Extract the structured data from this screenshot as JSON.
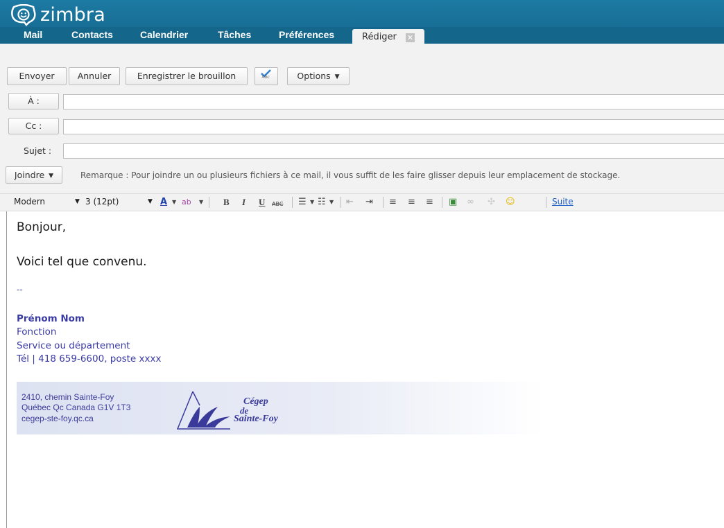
{
  "app": {
    "name": "zimbra"
  },
  "nav": {
    "tabs": [
      "Mail",
      "Contacts",
      "Calendrier",
      "Tâches",
      "Préférences"
    ],
    "active_tab": "Rédiger",
    "close_glyph": "✕"
  },
  "toolbar": {
    "send": "Envoyer",
    "cancel": "Annuler",
    "save_draft": "Enregistrer le brouillon",
    "spellcheck_text": "Abc",
    "options": "Options"
  },
  "fields": {
    "to_label": "À :",
    "cc_label": "Cc :",
    "subject_label": "Sujet :",
    "to_value": "",
    "cc_value": "",
    "subject_value": ""
  },
  "attach": {
    "label": "Joindre",
    "note": "Remarque : Pour joindre un ou plusieurs fichiers à ce mail, il vous suffit de les faire glisser depuis leur emplacement de stockage."
  },
  "format": {
    "font": "Modern",
    "size": "3 (12pt)",
    "more": "Suite"
  },
  "message": {
    "greeting": "Bonjour,",
    "line": "Voici tel que convenu.",
    "sig_dash": "--",
    "name": "Prénom Nom",
    "title": "Fonction",
    "department": "Service ou département",
    "phone": "Tél | 418 659-6600, poste xxxx"
  },
  "banner": {
    "address1": "2410, chemin Sainte-Foy",
    "address2": "Québec Qc Canada G1V 1T3",
    "website": "cegep-ste-foy.qc.ca",
    "logo_line1": "Cégep",
    "logo_line2": "de",
    "logo_line3": "Sainte-Foy"
  },
  "colors": {
    "header": "#1d7aa3",
    "signature": "#3a3aa6",
    "link": "#1a5dc8"
  }
}
